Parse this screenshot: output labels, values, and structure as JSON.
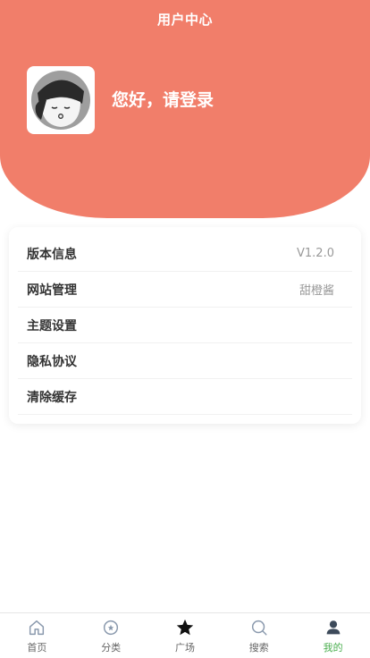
{
  "header": {
    "title": "用户中心"
  },
  "profile": {
    "greeting": "您好，请登录"
  },
  "menu": [
    {
      "label": "版本信息",
      "value": "V1.2.0"
    },
    {
      "label": "网站管理",
      "value": "甜橙酱"
    },
    {
      "label": "主题设置",
      "value": ""
    },
    {
      "label": "隐私协议",
      "value": ""
    },
    {
      "label": "清除缓存",
      "value": ""
    }
  ],
  "tabs": [
    {
      "label": "首页",
      "icon": "home-icon"
    },
    {
      "label": "分类",
      "icon": "category-icon"
    },
    {
      "label": "广场",
      "icon": "star-icon"
    },
    {
      "label": "搜索",
      "icon": "search-icon"
    },
    {
      "label": "我的",
      "icon": "user-icon",
      "active": true
    }
  ],
  "colors": {
    "accent": "#f17e6a",
    "active_tab": "#4caf50"
  }
}
